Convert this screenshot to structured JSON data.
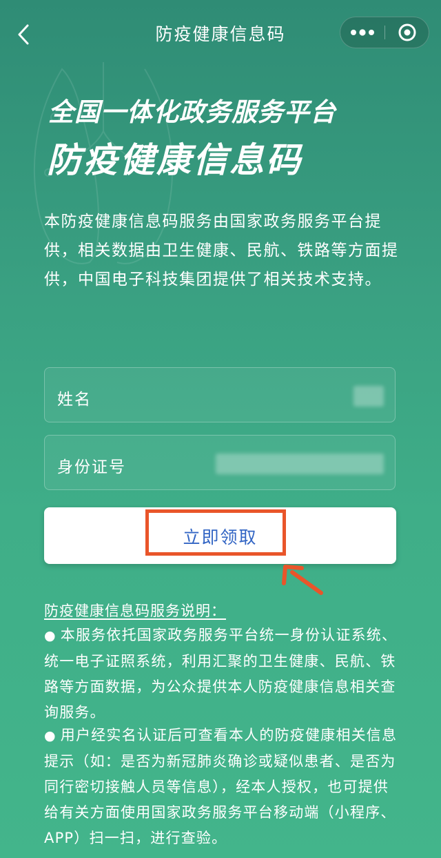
{
  "nav": {
    "title": "防疫健康信息码",
    "back_icon": "chevron-left-icon",
    "more_icon": "more-dots-icon",
    "close_icon": "target-close-icon"
  },
  "header": {
    "line1": "全国一体化政务服务平台",
    "line2": "防疫健康信息码"
  },
  "intro": "本防疫健康信息码服务由国家政务服务平台提供，相关数据由卫生健康、民航、铁路等方面提供，中国电子科技集团提供了相关技术支持。",
  "form": {
    "name_label": "姓名",
    "id_label": "身份证号",
    "submit_label": "立即领取"
  },
  "notes": {
    "title": "防疫健康信息码服务说明：",
    "bullet": "●",
    "items": [
      "本服务依托国家政务服务平台统一身份认证系统、统一电子证照系统，利用汇聚的卫生健康、民航、铁路等方面数据，为公众提供本人防疫健康信息相关查询服务。",
      "用户经实名认证后可查看本人的防疫健康相关信息提示（如：是否为新冠肺炎确诊或疑似患者、是否为同行密切接触人员等信息），经本人授权，也可提供给有关方面使用国家政务服务平台移动端（小程序、APP）扫一扫，进行查验。"
    ]
  },
  "colors": {
    "background_top": "#2f8c75",
    "background_bottom": "#43b58b",
    "button_text": "#3265c4",
    "highlight": "#e9552a"
  }
}
